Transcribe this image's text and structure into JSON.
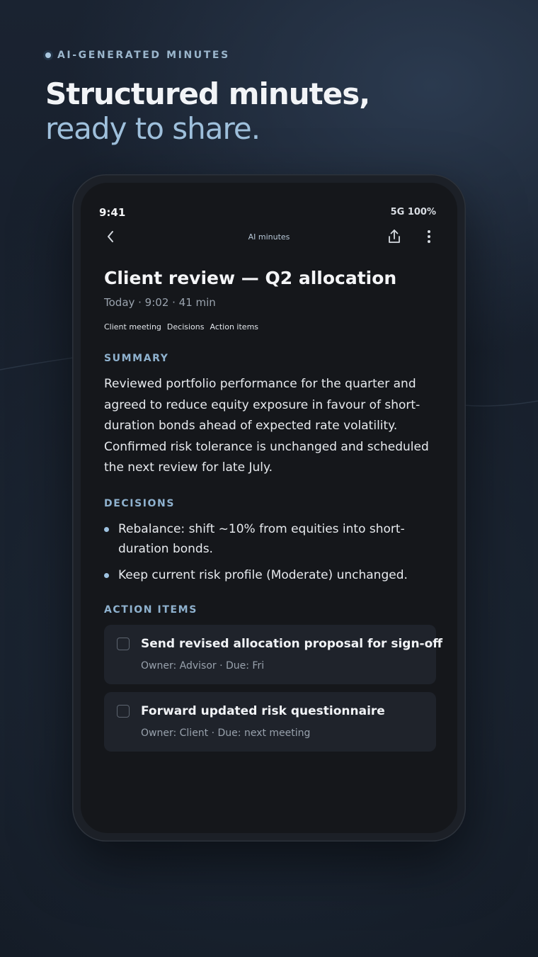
{
  "hero": {
    "eyebrow": "AI-GENERATED MINUTES",
    "line1": "Structured minutes,",
    "line2": "ready to share."
  },
  "status_bar": {
    "time": "9:41",
    "network": "5G",
    "battery": "100%"
  },
  "nav": {
    "title": "AI minutes",
    "back_icon": "chevron-left-icon",
    "share_icon": "share-icon",
    "more_icon": "more-vertical-icon"
  },
  "document": {
    "title": "Client review — Q2 allocation",
    "meta": "Today · 9:02 · 41 min",
    "tags": [
      "Client meeting",
      "Decisions",
      "Action items"
    ]
  },
  "summary": {
    "label": "SUMMARY",
    "text": "Reviewed portfolio performance for the quarter and agreed to reduce equity exposure in favour of short-duration bonds ahead of expected rate volatility. Confirmed risk tolerance is unchanged and scheduled the next review for late July."
  },
  "decisions": {
    "label": "DECISIONS",
    "items": [
      "Rebalance: shift ~10% from equities into short-duration bonds.",
      "Keep current risk profile (Moderate) unchanged."
    ]
  },
  "action_items": {
    "label": "ACTION ITEMS",
    "items": [
      {
        "title": "Send revised allocation proposal for sign-off",
        "subtitle": "Owner: Advisor · Due: Fri",
        "checked": false
      },
      {
        "title": "Forward updated risk questionnaire",
        "subtitle": "Owner: Client · Due: next meeting",
        "checked": false
      }
    ]
  },
  "colors": {
    "accent": "#9fc0dc",
    "screen_bg": "#15171b",
    "card_bg": "#1f232b"
  }
}
